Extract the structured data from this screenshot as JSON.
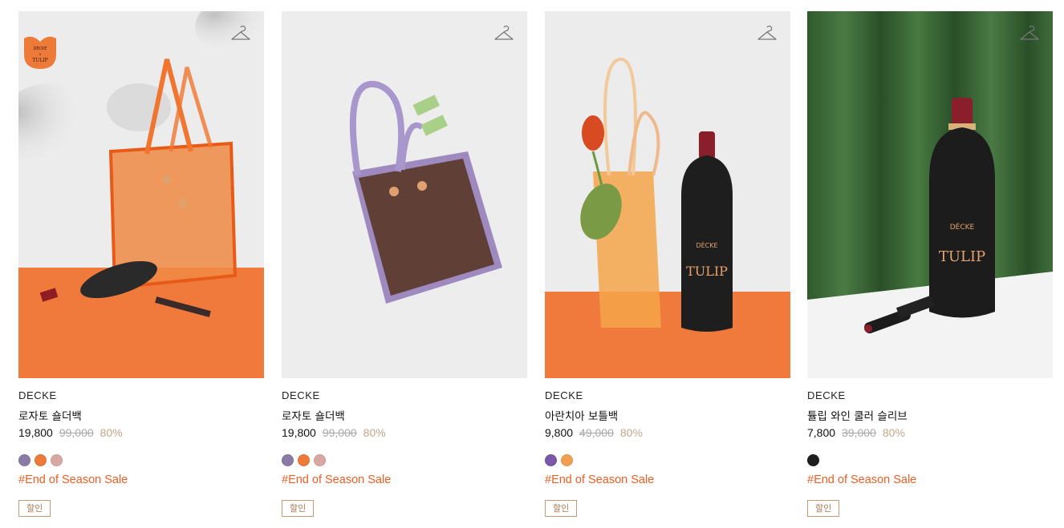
{
  "colors": {
    "accent_tag": "#ee5d23",
    "discount_rate": "#c6a588",
    "badge_border": "#c69a72"
  },
  "products": [
    {
      "brand": "DECKE",
      "name": "로자토 숄더백",
      "sale_price": "19,800",
      "original_price": "99,000",
      "discount_rate": "80%",
      "swatches": [
        "#8a7aa6",
        "#ee7a3a",
        "#d9a8a2"
      ],
      "tag": "#End of Season Sale",
      "badge": "할인",
      "logo_lines": [
        "DECKE",
        "x",
        "TULIP"
      ],
      "icon": "hanger-icon"
    },
    {
      "brand": "DECKE",
      "name": "로자토 숄더백",
      "sale_price": "19,800",
      "original_price": "99,000",
      "discount_rate": "80%",
      "swatches": [
        "#8a7aa6",
        "#ee7a3a",
        "#d9a8a2"
      ],
      "tag": "#End of Season Sale",
      "badge": "할인",
      "icon": "hanger-icon"
    },
    {
      "brand": "DECKE",
      "name": "아란치아 보틀백",
      "sale_price": "9,800",
      "original_price": "49,000",
      "discount_rate": "80%",
      "swatches": [
        "#7b58a8",
        "#f0a050"
      ],
      "tag": "#End of Season Sale",
      "badge": "할인",
      "icon": "hanger-icon"
    },
    {
      "brand": "DECKE",
      "name": "튤립 와인 쿨러 슬리브",
      "sale_price": "7,800",
      "original_price": "39,000",
      "discount_rate": "80%",
      "swatches": [
        "#1e1e1e"
      ],
      "tag": "#End of Season Sale",
      "badge": "할인",
      "icon": "hanger-icon"
    }
  ]
}
